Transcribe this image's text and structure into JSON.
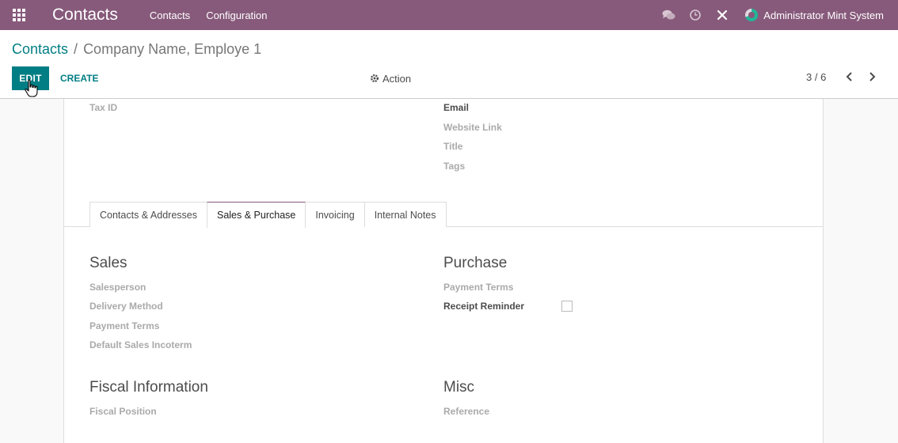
{
  "navbar": {
    "brand": "Contacts",
    "menu": [
      "Contacts",
      "Configuration"
    ],
    "user": "Administrator Mint System",
    "icons": [
      "apps-grid-icon",
      "chat-icon",
      "clock-icon",
      "tools-icon"
    ],
    "color": "#875a7b"
  },
  "breadcrumb": {
    "parent": "Contacts",
    "separator": "/",
    "current": "Company Name, Employe 1"
  },
  "toolbar": {
    "edit_label": "EDIT",
    "create_label": "CREATE",
    "action_label": "Action",
    "pager_value": "3 / 6",
    "accent": "#017e84"
  },
  "form": {
    "left_fields": [
      "Tax ID"
    ],
    "right_fields": [
      "Email",
      "Website Link",
      "Title",
      "Tags"
    ],
    "tabs": [
      "Contacts & Addresses",
      "Sales & Purchase",
      "Invoicing",
      "Internal Notes"
    ],
    "active_tab": "Sales & Purchase",
    "sales": {
      "title": "Sales",
      "fields": [
        "Salesperson",
        "Delivery Method",
        "Payment Terms",
        "Default Sales Incoterm"
      ]
    },
    "purchase": {
      "title": "Purchase",
      "fields": [
        "Payment Terms",
        "Receipt Reminder"
      ],
      "receipt_reminder_checked": false
    },
    "fiscal": {
      "title": "Fiscal Information",
      "fields": [
        "Fiscal Position"
      ]
    },
    "misc": {
      "title": "Misc",
      "fields": [
        "Reference"
      ]
    }
  }
}
